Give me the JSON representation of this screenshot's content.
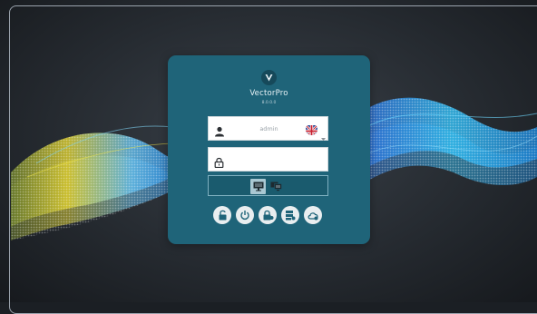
{
  "app": {
    "name": "VectorPro",
    "version": "8.0.0.0"
  },
  "login": {
    "username_value": "admin",
    "password_value": "",
    "language_flag": "uk-flag-icon"
  },
  "display_modes": [
    {
      "icon": "single-monitor-icon",
      "selected": true
    },
    {
      "icon": "dual-monitor-icon",
      "selected": false
    }
  ],
  "actions": [
    {
      "icon": "unlock-icon"
    },
    {
      "icon": "power-icon"
    },
    {
      "icon": "lock-settings-icon"
    },
    {
      "icon": "server-settings-icon"
    },
    {
      "icon": "cloud-settings-icon"
    }
  ],
  "colors": {
    "panel": "#1f6479",
    "accent": "#a9c8d3",
    "background": "#262b31"
  }
}
